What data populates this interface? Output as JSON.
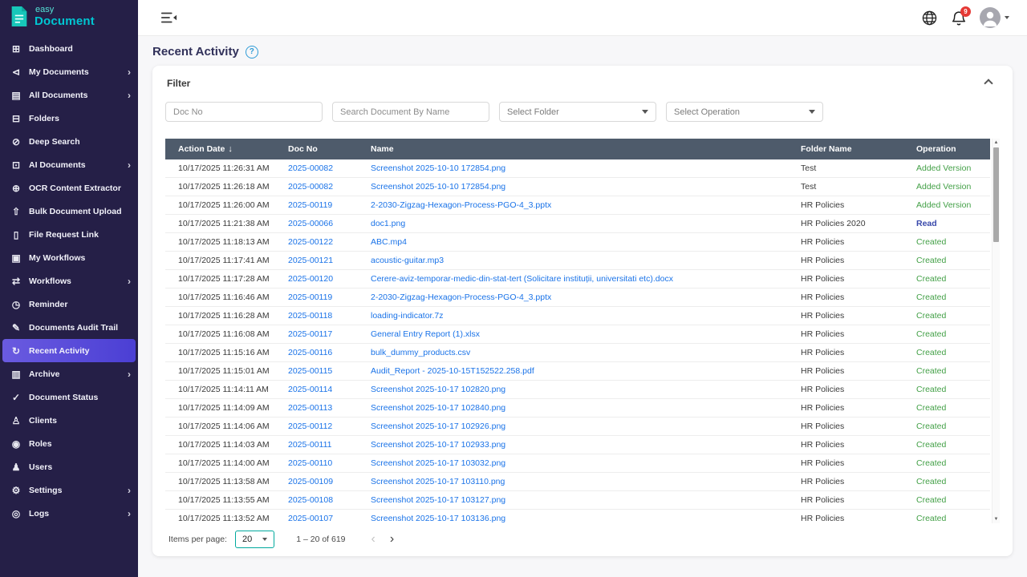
{
  "colors": {
    "sidebar_bg": "#251f47",
    "sidebar_active_1": "#6a5be0",
    "sidebar_active_2": "#4b3fd4",
    "table_header_bg": "#4e5b6b",
    "link": "#1a73e8",
    "op_green": "#43a047",
    "op_read": "#3949ab",
    "badge_red": "#e53935",
    "accent_teal": "#00a99d",
    "help_blue": "#2e9bd6"
  },
  "icons": {
    "dashboard": "⊞",
    "my-documents": "⊲",
    "all-documents": "▤",
    "folders": "⊟",
    "deep-search": "⊘",
    "ai-documents": "⊡",
    "ocr-extractor": "⊕",
    "bulk-upload": "⇧",
    "file-request": "▯",
    "my-workflows": "▣",
    "workflows": "⇄",
    "reminder": "◷",
    "audit-trail": "✎",
    "recent-activity": "↻",
    "archive": "▥",
    "document-status": "✓",
    "clients": "♙",
    "roles": "◉",
    "users": "♟",
    "settings": "⚙",
    "logs": "◎",
    "chevron_right": "›",
    "chevron_left": "‹",
    "sort_desc": "↓",
    "scroll_up": "▲",
    "scroll_down": "▼",
    "help": "?"
  },
  "app": {
    "logo_easy": "easy",
    "logo_document": "Document"
  },
  "topbar": {
    "notification_count": "9"
  },
  "sidebar": {
    "items": [
      {
        "label": "Dashboard",
        "icon": "dashboard"
      },
      {
        "label": "My Documents",
        "icon": "my-documents",
        "expandable": true
      },
      {
        "label": "All Documents",
        "icon": "all-documents",
        "expandable": true
      },
      {
        "label": "Folders",
        "icon": "folders"
      },
      {
        "label": "Deep Search",
        "icon": "deep-search"
      },
      {
        "label": "AI Documents",
        "icon": "ai-documents",
        "expandable": true
      },
      {
        "label": "OCR Content Extractor",
        "icon": "ocr-extractor"
      },
      {
        "label": "Bulk Document Upload",
        "icon": "bulk-upload"
      },
      {
        "label": "File Request Link",
        "icon": "file-request"
      },
      {
        "label": "My Workflows",
        "icon": "my-workflows"
      },
      {
        "label": "Workflows",
        "icon": "workflows",
        "expandable": true
      },
      {
        "label": "Reminder",
        "icon": "reminder"
      },
      {
        "label": "Documents Audit Trail",
        "icon": "audit-trail"
      },
      {
        "label": "Recent Activity",
        "icon": "recent-activity",
        "active": true
      },
      {
        "label": "Archive",
        "icon": "archive",
        "expandable": true
      },
      {
        "label": "Document Status",
        "icon": "document-status"
      },
      {
        "label": "Clients",
        "icon": "clients"
      },
      {
        "label": "Roles",
        "icon": "roles"
      },
      {
        "label": "Users",
        "icon": "users"
      },
      {
        "label": "Settings",
        "icon": "settings",
        "expandable": true
      },
      {
        "label": "Logs",
        "icon": "logs",
        "expandable": true
      }
    ]
  },
  "page": {
    "title": "Recent Activity"
  },
  "filter": {
    "title": "Filter",
    "doc_no_placeholder": "Doc No",
    "name_placeholder": "Search Document By Name",
    "folder_placeholder": "Select Folder",
    "operation_placeholder": "Select Operation"
  },
  "table": {
    "headers": [
      "Action Date",
      "Doc No",
      "Name",
      "Folder Name",
      "Operation"
    ],
    "rows": [
      {
        "date": "10/17/2025 11:26:31 AM",
        "doc_no": "2025-00082",
        "name": "Screenshot 2025-10-10 172854.png",
        "folder": "Test",
        "operation": "Added Version",
        "op_style": "green"
      },
      {
        "date": "10/17/2025 11:26:18 AM",
        "doc_no": "2025-00082",
        "name": "Screenshot 2025-10-10 172854.png",
        "folder": "Test",
        "operation": "Added Version",
        "op_style": "green"
      },
      {
        "date": "10/17/2025 11:26:00 AM",
        "doc_no": "2025-00119",
        "name": "2-2030-Zigzag-Hexagon-Process-PGO-4_3.pptx",
        "folder": "HR Policies",
        "operation": "Added Version",
        "op_style": "green"
      },
      {
        "date": "10/17/2025 11:21:38 AM",
        "doc_no": "2025-00066",
        "name": "doc1.png",
        "folder": "HR Policies 2020",
        "operation": "Read",
        "op_style": "read"
      },
      {
        "date": "10/17/2025 11:18:13 AM",
        "doc_no": "2025-00122",
        "name": "ABC.mp4",
        "folder": "HR Policies",
        "operation": "Created",
        "op_style": "green"
      },
      {
        "date": "10/17/2025 11:17:41 AM",
        "doc_no": "2025-00121",
        "name": "acoustic-guitar.mp3",
        "folder": "HR Policies",
        "operation": "Created",
        "op_style": "green"
      },
      {
        "date": "10/17/2025 11:17:28 AM",
        "doc_no": "2025-00120",
        "name": "Cerere-aviz-temporar-medic-din-stat-tert (Solicitare instituții, universitati etc).docx",
        "folder": "HR Policies",
        "operation": "Created",
        "op_style": "green"
      },
      {
        "date": "10/17/2025 11:16:46 AM",
        "doc_no": "2025-00119",
        "name": "2-2030-Zigzag-Hexagon-Process-PGO-4_3.pptx",
        "folder": "HR Policies",
        "operation": "Created",
        "op_style": "green"
      },
      {
        "date": "10/17/2025 11:16:28 AM",
        "doc_no": "2025-00118",
        "name": "loading-indicator.7z",
        "folder": "HR Policies",
        "operation": "Created",
        "op_style": "green"
      },
      {
        "date": "10/17/2025 11:16:08 AM",
        "doc_no": "2025-00117",
        "name": "General Entry Report (1).xlsx",
        "folder": "HR Policies",
        "operation": "Created",
        "op_style": "green"
      },
      {
        "date": "10/17/2025 11:15:16 AM",
        "doc_no": "2025-00116",
        "name": "bulk_dummy_products.csv",
        "folder": "HR Policies",
        "operation": "Created",
        "op_style": "green"
      },
      {
        "date": "10/17/2025 11:15:01 AM",
        "doc_no": "2025-00115",
        "name": "Audit_Report - 2025-10-15T152522.258.pdf",
        "folder": "HR Policies",
        "operation": "Created",
        "op_style": "green"
      },
      {
        "date": "10/17/2025 11:14:11 AM",
        "doc_no": "2025-00114",
        "name": "Screenshot 2025-10-17 102820.png",
        "folder": "HR Policies",
        "operation": "Created",
        "op_style": "green"
      },
      {
        "date": "10/17/2025 11:14:09 AM",
        "doc_no": "2025-00113",
        "name": "Screenshot 2025-10-17 102840.png",
        "folder": "HR Policies",
        "operation": "Created",
        "op_style": "green"
      },
      {
        "date": "10/17/2025 11:14:06 AM",
        "doc_no": "2025-00112",
        "name": "Screenshot 2025-10-17 102926.png",
        "folder": "HR Policies",
        "operation": "Created",
        "op_style": "green"
      },
      {
        "date": "10/17/2025 11:14:03 AM",
        "doc_no": "2025-00111",
        "name": "Screenshot 2025-10-17 102933.png",
        "folder": "HR Policies",
        "operation": "Created",
        "op_style": "green"
      },
      {
        "date": "10/17/2025 11:14:00 AM",
        "doc_no": "2025-00110",
        "name": "Screenshot 2025-10-17 103032.png",
        "folder": "HR Policies",
        "operation": "Created",
        "op_style": "green"
      },
      {
        "date": "10/17/2025 11:13:58 AM",
        "doc_no": "2025-00109",
        "name": "Screenshot 2025-10-17 103110.png",
        "folder": "HR Policies",
        "operation": "Created",
        "op_style": "green"
      },
      {
        "date": "10/17/2025 11:13:55 AM",
        "doc_no": "2025-00108",
        "name": "Screenshot 2025-10-17 103127.png",
        "folder": "HR Policies",
        "operation": "Created",
        "op_style": "green"
      },
      {
        "date": "10/17/2025 11:13:52 AM",
        "doc_no": "2025-00107",
        "name": "Screenshot 2025-10-17 103136.png",
        "folder": "HR Policies",
        "operation": "Created",
        "op_style": "green"
      }
    ]
  },
  "pagination": {
    "items_per_page_label": "Items per page:",
    "page_size": "20",
    "range": "1 – 20 of 619"
  }
}
